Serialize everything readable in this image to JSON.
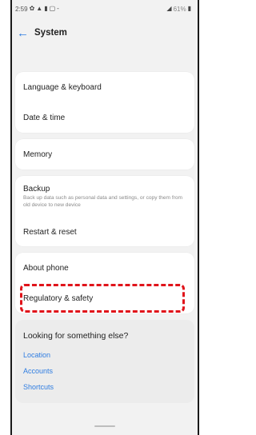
{
  "status_bar": {
    "time": "2:59",
    "icons_left": [
      "gear-icon",
      "a-icon",
      "lock-icon",
      "image-icon",
      "dash-icon"
    ],
    "battery_text": "61%"
  },
  "header": {
    "title": "System"
  },
  "groups": [
    {
      "items": [
        {
          "label": "Language & keyboard"
        },
        {
          "label": "Date & time"
        }
      ]
    },
    {
      "items": [
        {
          "label": "Memory"
        }
      ]
    },
    {
      "items": [
        {
          "label": "Backup",
          "sub": "Back up data such as personal data and settings, or copy them from old device to new device"
        },
        {
          "label": "Restart & reset"
        }
      ]
    },
    {
      "items": [
        {
          "label": "About phone"
        },
        {
          "label": "Regulatory & safety"
        }
      ]
    }
  ],
  "more": {
    "title": "Looking for something else?",
    "links": [
      "Location",
      "Accounts",
      "Shortcuts"
    ]
  },
  "colors": {
    "accent": "#2f7de1",
    "highlight": "#e0141b",
    "background": "#f2f2f2"
  }
}
